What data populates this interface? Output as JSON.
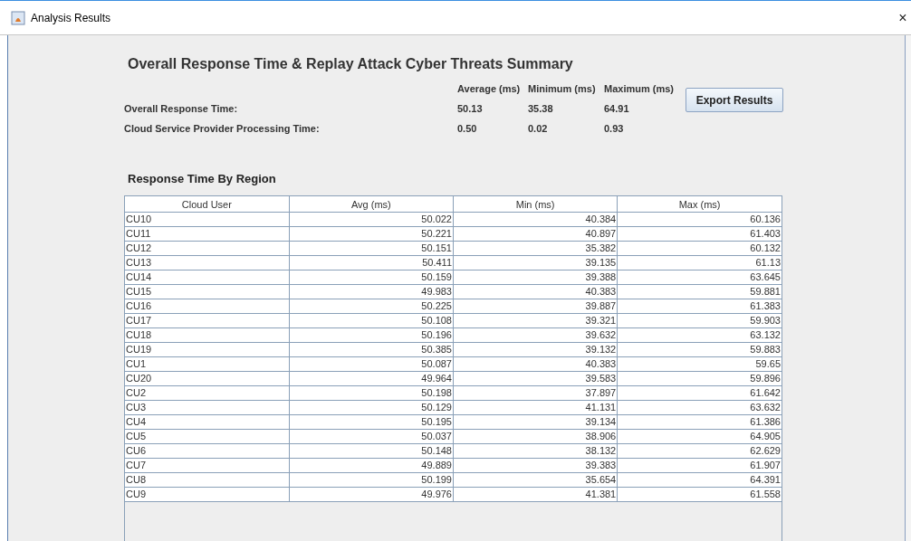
{
  "window": {
    "title": "Analysis Results",
    "close": "×"
  },
  "summary": {
    "title": "Overall Response Time & Replay Attack Cyber Threats Summary",
    "columns": [
      "Average (ms)",
      "Minimum (ms)",
      "Maximum (ms)"
    ],
    "rows": [
      {
        "label": "Overall Response Time:",
        "values": [
          "50.13",
          "35.38",
          "64.91"
        ]
      },
      {
        "label": "Cloud Service Provider Processing Time:",
        "values": [
          "0.50",
          "0.02",
          "0.93"
        ]
      }
    ]
  },
  "export_button": "Export Results",
  "table": {
    "title": "Response Time By Region",
    "columns": [
      "Cloud User",
      "Avg (ms)",
      "Min (ms)",
      "Max (ms)"
    ],
    "rows": [
      [
        "CU10",
        "50.022",
        "40.384",
        "60.136"
      ],
      [
        "CU11",
        "50.221",
        "40.897",
        "61.403"
      ],
      [
        "CU12",
        "50.151",
        "35.382",
        "60.132"
      ],
      [
        "CU13",
        "50.411",
        "39.135",
        "61.13"
      ],
      [
        "CU14",
        "50.159",
        "39.388",
        "63.645"
      ],
      [
        "CU15",
        "49.983",
        "40.383",
        "59.881"
      ],
      [
        "CU16",
        "50.225",
        "39.887",
        "61.383"
      ],
      [
        "CU17",
        "50.108",
        "39.321",
        "59.903"
      ],
      [
        "CU18",
        "50.196",
        "39.632",
        "63.132"
      ],
      [
        "CU19",
        "50.385",
        "39.132",
        "59.883"
      ],
      [
        "CU1",
        "50.087",
        "40.383",
        "59.65"
      ],
      [
        "CU20",
        "49.964",
        "39.583",
        "59.896"
      ],
      [
        "CU2",
        "50.198",
        "37.897",
        "61.642"
      ],
      [
        "CU3",
        "50.129",
        "41.131",
        "63.632"
      ],
      [
        "CU4",
        "50.195",
        "39.134",
        "61.386"
      ],
      [
        "CU5",
        "50.037",
        "38.906",
        "64.905"
      ],
      [
        "CU6",
        "50.148",
        "38.132",
        "62.629"
      ],
      [
        "CU7",
        "49.889",
        "39.383",
        "61.907"
      ],
      [
        "CU8",
        "50.199",
        "35.654",
        "64.391"
      ],
      [
        "CU9",
        "49.976",
        "41.381",
        "61.558"
      ]
    ]
  }
}
